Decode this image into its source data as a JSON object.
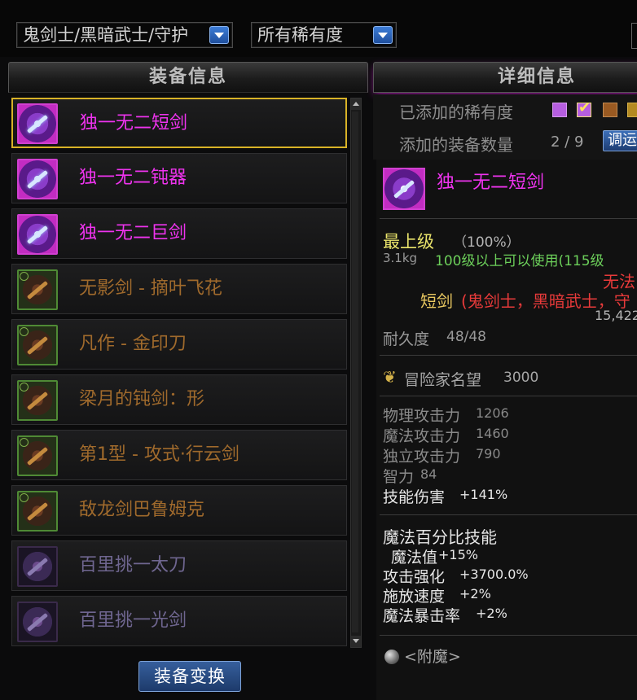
{
  "filters": {
    "class_select": "鬼剑士/黑暗武士/守护",
    "rarity_select": "所有稀有度"
  },
  "left": {
    "header": "装备信息",
    "items": [
      {
        "name": "独一无二短剑",
        "rarity": "epic"
      },
      {
        "name": "独一无二钝器",
        "rarity": "epic"
      },
      {
        "name": "独一无二巨剑",
        "rarity": "epic"
      },
      {
        "name": "无影剑 - 摘叶飞花",
        "rarity": "legendary"
      },
      {
        "name": "凡作 - 金印刀",
        "rarity": "legendary"
      },
      {
        "name": "梁月的钝剑：形",
        "rarity": "legendary"
      },
      {
        "name": "第1型 - 攻式·行云剑",
        "rarity": "legendary"
      },
      {
        "name": "敌龙剑巴鲁姆克",
        "rarity": "legendary"
      },
      {
        "name": "百里挑一太刀",
        "rarity": "rare"
      },
      {
        "name": "百里挑一光剑",
        "rarity": "rare"
      }
    ],
    "button": "装备变换"
  },
  "right": {
    "header": "详细信息",
    "rarity_label": "已添加的稀有度",
    "count_label": "添加的装备数量",
    "count_value": "2 / 9",
    "adjust_button": "调运",
    "item_name": "独一无二短剑",
    "grade": "最上级",
    "grade_pct": "（100%）",
    "weight": "3.1kg",
    "level_req": "100级以上可以使用(115级",
    "warning": "无法",
    "type": "短剑",
    "classes": "(鬼剑士，黑暗武士，守",
    "price": "15,422",
    "durability_label": "耐久度",
    "durability_value": "48/48",
    "fame_label": "冒险家名望",
    "fame_value": "3000",
    "stats": [
      {
        "label": "物理攻击力",
        "value": "1206"
      },
      {
        "label": "魔法攻击力",
        "value": "1460"
      },
      {
        "label": "独立攻击力",
        "value": "790"
      },
      {
        "label": "智力",
        "value": "84"
      },
      {
        "label": "技能伤害",
        "value": "+141%"
      }
    ],
    "options_header": "魔法百分比技能",
    "options": [
      {
        "label": "魔法值",
        "value": "+15%"
      },
      {
        "label": "攻击强化",
        "value": "+3700.0%"
      },
      {
        "label": "施放速度",
        "value": "+2%"
      },
      {
        "label": "魔法暴击率",
        "value": "+2%"
      }
    ],
    "enchant": "<附魔>"
  },
  "colors": {
    "epic": "#ee33ee",
    "legendary": "#a06a2c",
    "rare": "#6f6690",
    "select_border": "#d8b227",
    "button_blue": "#2a4f8a"
  }
}
